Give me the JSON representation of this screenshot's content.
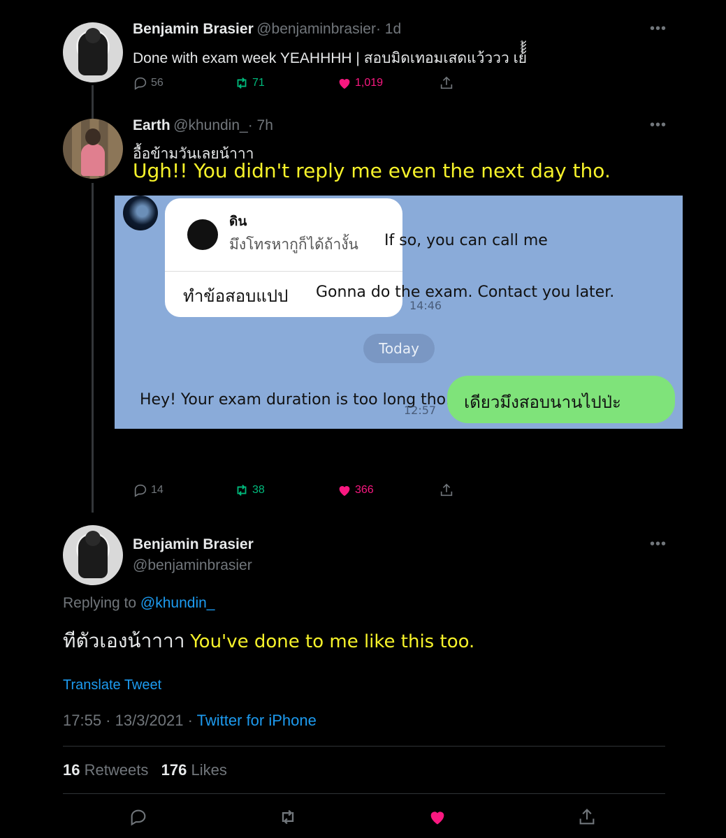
{
  "tweet1": {
    "name": "Benjamin Brasier",
    "handle": "@benjaminbrasier",
    "time": "· 1d",
    "text": "Done with exam week YEAHHHH | สอบมิดเทอมเสดแว้ววว เย้้้้",
    "replies": "56",
    "retweets": "71",
    "likes": "1,019"
  },
  "tweet2": {
    "name": "Earth",
    "handle": "@khundin_",
    "time": "· 7h",
    "text_thai": "อื้อข้ามวันเลยน้าาา",
    "translation": "Ugh!! You didn't reply me even the next day tho.",
    "replies": "14",
    "retweets": "38",
    "likes": "366",
    "chat": {
      "quoted_name": "ดิน",
      "quoted_text": "มึงโทรหากูก็ได้ถ้างั้น",
      "quoted_translation": "If so, you can call me",
      "reply_text": "ทำข้อสอบแปป",
      "reply_translation": "Gonna do the exam. Contact you later.",
      "time1": "14:46",
      "day_label": "Today",
      "sent_translation": "Hey! Your exam duration is too long tho.",
      "sent_text": "เดียวมึงสอบนานไปป่ะ",
      "time2": "12:57"
    }
  },
  "tweet3": {
    "name": "Benjamin Brasier",
    "handle": "@benjaminbrasier",
    "replying_label": "Replying to",
    "replying_handle": "@khundin_",
    "text_thai": "ทีตัวเองน้าาาา",
    "translation": "You've done to me like this too.",
    "translate_link": "Translate Tweet",
    "timestamp": "17:55 · 13/3/2021 ·",
    "source": "Twitter for iPhone",
    "retweets_count": "16",
    "retweets_label": "Retweets",
    "likes_count": "176",
    "likes_label": "Likes"
  },
  "more_glyph": "•••",
  "colors": {
    "background": "#000000",
    "like_pink": "#f91880",
    "retweet_green": "#00ba7c",
    "link_blue": "#1d9bf0",
    "translation_yellow": "#f6f22a",
    "chat_background": "#8aabd9",
    "chat_sent_bubble": "#7fe37a"
  },
  "icons": [
    "reply-icon",
    "retweet-icon",
    "heart-icon",
    "share-icon",
    "more-icon"
  ]
}
